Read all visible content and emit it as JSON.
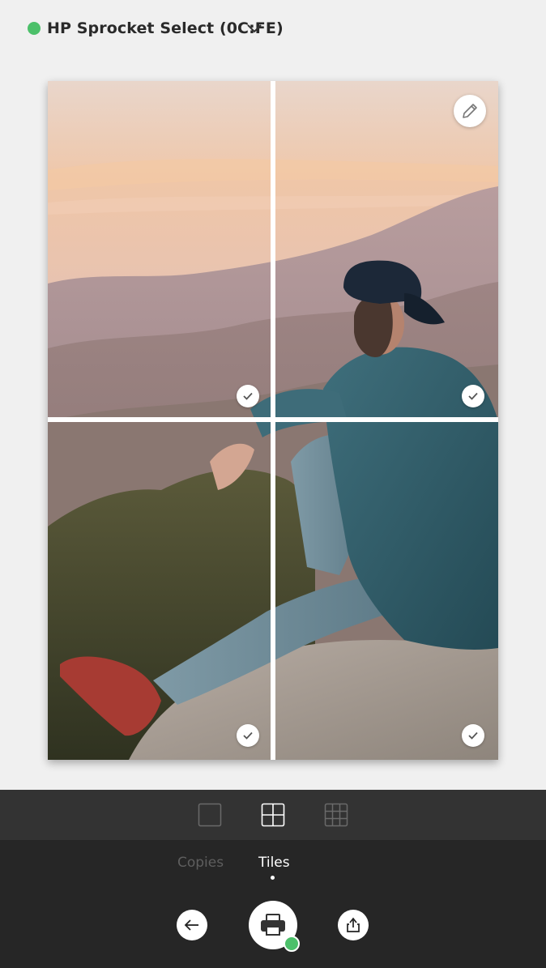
{
  "header": {
    "printer_name": "HP Sprocket Select (0C:FE)",
    "status": "connected",
    "status_color": "#4cc06a",
    "chevron_icon": "chevron-down-icon"
  },
  "photo": {
    "description_icon": "photo-image",
    "tiles": [
      {
        "position": "top-left",
        "selected": true
      },
      {
        "position": "top-right",
        "selected": true
      },
      {
        "position": "bottom-left",
        "selected": true
      },
      {
        "position": "bottom-right",
        "selected": true
      }
    ],
    "edit_icon": "pencil-icon"
  },
  "layout_options": [
    {
      "name": "single",
      "icon": "single-tile-icon",
      "selected": false
    },
    {
      "name": "2x2",
      "icon": "grid-2x2-icon",
      "selected": true
    },
    {
      "name": "3x3",
      "icon": "grid-3x3-icon",
      "selected": false
    }
  ],
  "tabs": [
    {
      "label": "Copies",
      "active": false
    },
    {
      "label": "Tiles",
      "active": true
    }
  ],
  "actions": {
    "back_icon": "arrow-left-icon",
    "print_icon": "printer-icon",
    "share_icon": "share-icon"
  },
  "colors": {
    "panel_top": "#333333",
    "panel_bottom": "#262626",
    "accent_green": "#4cc06a"
  }
}
